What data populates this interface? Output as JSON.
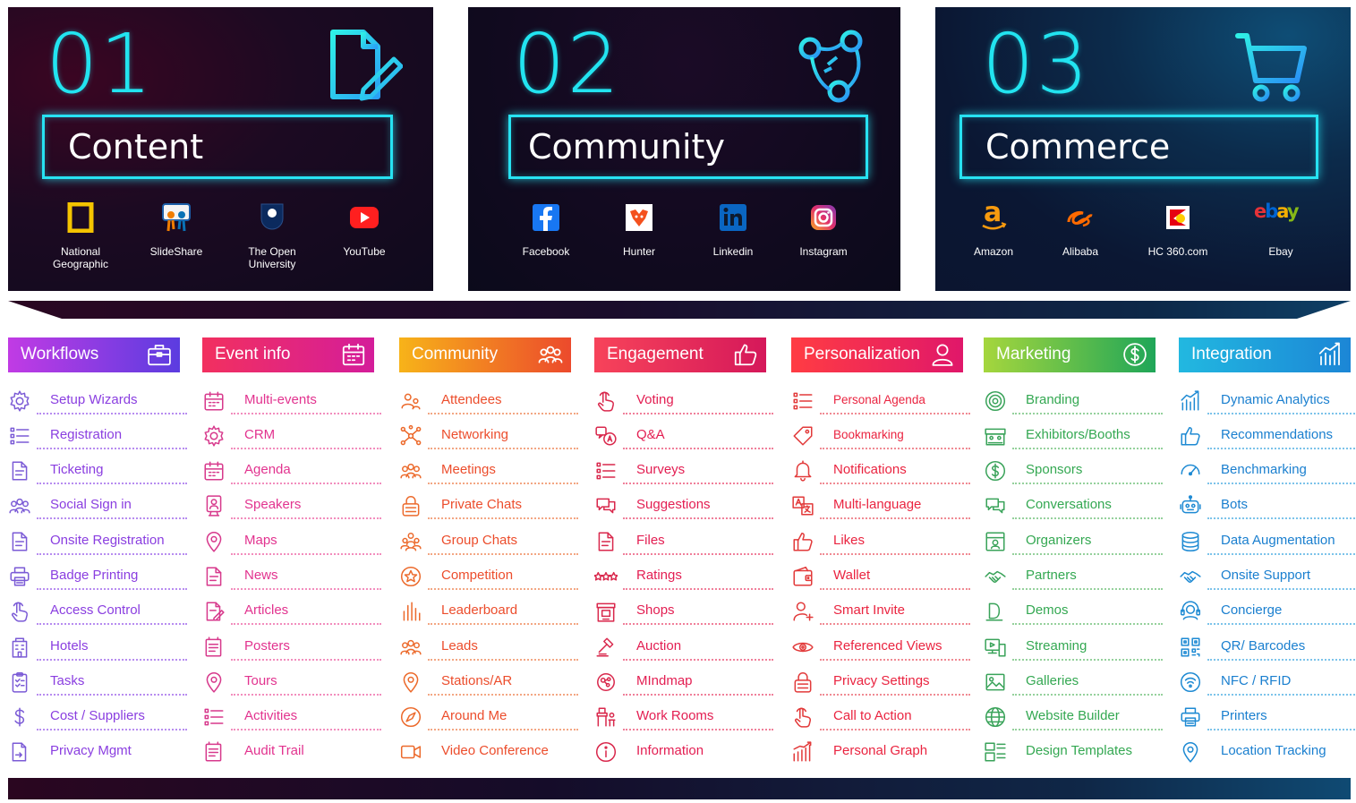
{
  "colors": {
    "cyan": "#22e4f0",
    "workflows": "#7a3de0",
    "event_info": "#e9247a",
    "community": "#f07c24",
    "engagement": "#e61e55",
    "personalization": "#ee2246",
    "marketing": "#59b84a",
    "integration": "#1ba0db"
  },
  "panels": [
    {
      "number": "01",
      "title": "Content",
      "icon": "document-edit-icon",
      "logos": [
        {
          "name": "National Geographic",
          "line1": "National",
          "line2": "Geographic",
          "icon": "national-geographic-icon"
        },
        {
          "name": "SlideShare",
          "line1": "SlideShare",
          "line2": "",
          "icon": "slideshare-icon"
        },
        {
          "name": "The Open University",
          "line1": "The Open",
          "line2": "University",
          "icon": "open-university-icon"
        },
        {
          "name": "YouTube",
          "line1": "YouTube",
          "line2": "",
          "icon": "youtube-icon"
        }
      ]
    },
    {
      "number": "02",
      "title": "Community",
      "icon": "network-icon",
      "logos": [
        {
          "name": "Facebook",
          "line1": "Facebook",
          "line2": "",
          "icon": "facebook-icon"
        },
        {
          "name": "Hunter",
          "line1": "Hunter",
          "line2": "",
          "icon": "hunter-icon"
        },
        {
          "name": "Linkedin",
          "line1": "Linkedin",
          "line2": "",
          "icon": "linkedin-icon"
        },
        {
          "name": "Instagram",
          "line1": "Instagram",
          "line2": "",
          "icon": "instagram-icon"
        }
      ]
    },
    {
      "number": "03",
      "title": "Commerce",
      "icon": "shopping-cart-icon",
      "logos": [
        {
          "name": "Amazon",
          "line1": "Amazon",
          "line2": "",
          "icon": "amazon-icon"
        },
        {
          "name": "Alibaba",
          "line1": "Alibaba",
          "line2": "",
          "icon": "alibaba-icon"
        },
        {
          "name": "HC 360.com",
          "line1": "HC 360.com",
          "line2": "",
          "icon": "hc360-icon"
        },
        {
          "name": "Ebay",
          "line1": "Ebay",
          "line2": "",
          "icon": "ebay-icon"
        }
      ]
    }
  ],
  "ebay_mark": {
    "e": "e",
    "b": "b",
    "a": "a",
    "y": "y"
  },
  "amazon_mark": "a",
  "columns": [
    {
      "title": "Workflows",
      "icon": "briefcase-icon",
      "items": [
        {
          "label": "Setup Wizards",
          "icon": "gear-icon"
        },
        {
          "label": "Registration",
          "icon": "list-icon"
        },
        {
          "label": "Ticketing",
          "icon": "document-icon"
        },
        {
          "label": "Social Sign in",
          "icon": "people-icon"
        },
        {
          "label": "Onsite Registration",
          "icon": "document-icon"
        },
        {
          "label": "Badge Printing",
          "icon": "printer-icon"
        },
        {
          "label": "Access Control",
          "icon": "hand-pointer-icon"
        },
        {
          "label": "Hotels",
          "icon": "hotel-icon"
        },
        {
          "label": "Tasks",
          "icon": "tasks-icon"
        },
        {
          "label": "Cost / Suppliers",
          "icon": "dollar-icon"
        },
        {
          "label": "Privacy Mgmt",
          "icon": "privacy-icon"
        }
      ]
    },
    {
      "title": "Event info",
      "icon": "calendar-icon",
      "items": [
        {
          "label": "Multi-events",
          "icon": "calendar-icon"
        },
        {
          "label": "CRM",
          "icon": "gear-icon"
        },
        {
          "label": "Agenda",
          "icon": "calendar-icon"
        },
        {
          "label": "Speakers",
          "icon": "speaker-icon"
        },
        {
          "label": "Maps",
          "icon": "map-pin-icon"
        },
        {
          "label": "News",
          "icon": "document-icon"
        },
        {
          "label": "Articles",
          "icon": "document-edit-icon"
        },
        {
          "label": "Posters",
          "icon": "poster-icon"
        },
        {
          "label": "Tours",
          "icon": "map-pin-icon"
        },
        {
          "label": "Activities",
          "icon": "list-icon"
        },
        {
          "label": "Audit Trail",
          "icon": "poster-icon"
        }
      ]
    },
    {
      "title": "Community",
      "icon": "people-icon",
      "items": [
        {
          "label": "Attendees",
          "icon": "attendees-icon"
        },
        {
          "label": "Networking",
          "icon": "network-icon"
        },
        {
          "label": "Meetings",
          "icon": "people-icon"
        },
        {
          "label": "Private Chats",
          "icon": "lock-icon"
        },
        {
          "label": "Group Chats",
          "icon": "group-icon"
        },
        {
          "label": "Competition",
          "icon": "star-icon"
        },
        {
          "label": "Leaderboard",
          "icon": "bar-chart-icon"
        },
        {
          "label": "Leads",
          "icon": "people-icon"
        },
        {
          "label": "Stations/AR",
          "icon": "map-pin-icon"
        },
        {
          "label": "Around Me",
          "icon": "compass-icon"
        },
        {
          "label": "Video Conference",
          "icon": "video-icon"
        }
      ]
    },
    {
      "title": "Engagement",
      "icon": "thumbs-up-icon",
      "items": [
        {
          "label": "Voting",
          "icon": "hand-pointer-icon"
        },
        {
          "label": "Q&A",
          "icon": "qa-icon"
        },
        {
          "label": "Surveys",
          "icon": "list-icon"
        },
        {
          "label": "Suggestions",
          "icon": "chat-icon"
        },
        {
          "label": "Files",
          "icon": "document-icon"
        },
        {
          "label": "Ratings",
          "icon": "stars-icon"
        },
        {
          "label": "Shops",
          "icon": "shop-icon"
        },
        {
          "label": "Auction",
          "icon": "gavel-icon"
        },
        {
          "label": "MIndmap",
          "icon": "mindmap-icon"
        },
        {
          "label": "Work Rooms",
          "icon": "desk-icon"
        },
        {
          "label": "Information",
          "icon": "info-icon"
        }
      ]
    },
    {
      "title": "Personalization",
      "icon": "user-icon",
      "items": [
        {
          "label": "Personal Agenda",
          "icon": "list-icon",
          "small": true
        },
        {
          "label": "Bookmarking",
          "icon": "tag-icon",
          "small": true
        },
        {
          "label": "Notifications",
          "icon": "bell-icon"
        },
        {
          "label": "Multi-language",
          "icon": "translate-icon"
        },
        {
          "label": "Likes",
          "icon": "thumbs-up-icon"
        },
        {
          "label": "Wallet",
          "icon": "wallet-icon"
        },
        {
          "label": "Smart Invite",
          "icon": "add-user-icon"
        },
        {
          "label": "Referenced Views",
          "icon": "eye-icon"
        },
        {
          "label": "Privacy Settings",
          "icon": "lock-icon"
        },
        {
          "label": "Call to Action",
          "icon": "hand-pointer-icon"
        },
        {
          "label": "Personal Graph",
          "icon": "graph-icon"
        }
      ]
    },
    {
      "title": "Marketing",
      "icon": "dollar-circle-icon",
      "items": [
        {
          "label": "Branding",
          "icon": "target-icon"
        },
        {
          "label": "Exhibitors/Booths",
          "icon": "booth-icon"
        },
        {
          "label": "Sponsors",
          "icon": "dollar-circle-icon"
        },
        {
          "label": "Conversations",
          "icon": "chat-icon"
        },
        {
          "label": "Organizers",
          "icon": "organizer-icon"
        },
        {
          "label": "Partners",
          "icon": "handshake-icon"
        },
        {
          "label": "Demos",
          "icon": "demo-icon"
        },
        {
          "label": "Streaming",
          "icon": "stream-icon"
        },
        {
          "label": "Galleries",
          "icon": "image-icon"
        },
        {
          "label": "Website Builder",
          "icon": "globe-icon"
        },
        {
          "label": "Design Templates",
          "icon": "template-icon"
        }
      ]
    },
    {
      "title": "Integration",
      "icon": "analytics-icon",
      "items": [
        {
          "label": "Dynamic Analytics",
          "icon": "analytics-icon"
        },
        {
          "label": "Recommendations",
          "icon": "thumbs-up-icon"
        },
        {
          "label": "Benchmarking",
          "icon": "gauge-icon"
        },
        {
          "label": "Bots",
          "icon": "bot-icon"
        },
        {
          "label": "Data Augmentation",
          "icon": "database-icon"
        },
        {
          "label": "Onsite Support",
          "icon": "handshake-icon"
        },
        {
          "label": "Concierge",
          "icon": "headset-icon"
        },
        {
          "label": "QR/ Barcodes",
          "icon": "qr-icon"
        },
        {
          "label": "NFC / RFID",
          "icon": "wireless-icon"
        },
        {
          "label": "Printers",
          "icon": "printer-icon"
        },
        {
          "label": "Location Tracking",
          "icon": "map-pin-icon"
        }
      ]
    }
  ]
}
